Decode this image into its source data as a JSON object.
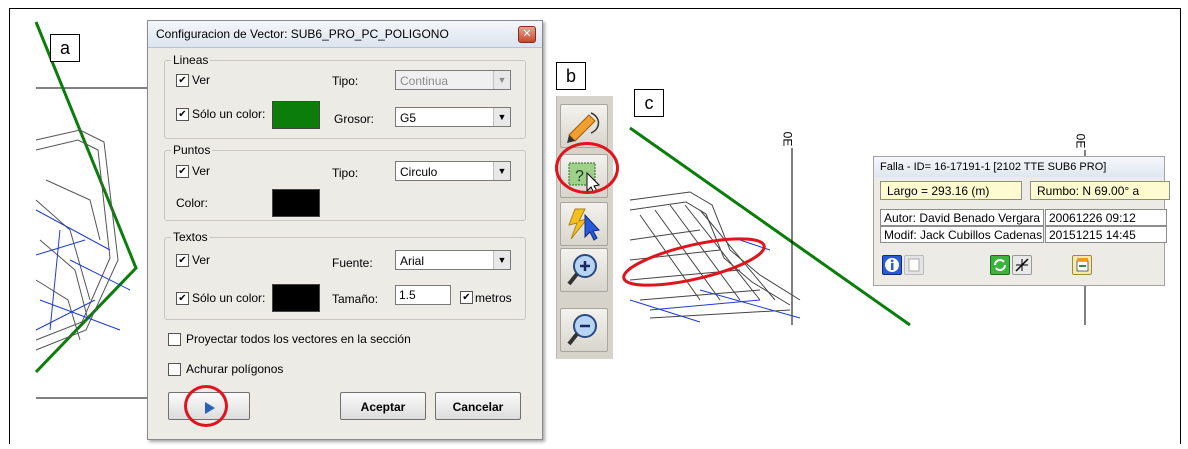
{
  "panels": {
    "a": "a",
    "b": "b",
    "c": "c"
  },
  "dialog": {
    "title": "Configuracion de Vector: SUB6_PRO_PC_POLIGONO",
    "close_glyph": "✕",
    "lineas": {
      "legend": "Lineas",
      "ver_label": "Ver",
      "ver_checked": true,
      "tipo_label": "Tipo:",
      "tipo_value": "Continua",
      "solo_label": "Sólo un color:",
      "solo_checked": true,
      "color": "#0a7d0a",
      "grosor_label": "Grosor:",
      "grosor_value": "G5"
    },
    "puntos": {
      "legend": "Puntos",
      "ver_label": "Ver",
      "ver_checked": true,
      "tipo_label": "Tipo:",
      "tipo_value": "Circulo",
      "color_label": "Color:",
      "color": "#000000"
    },
    "textos": {
      "legend": "Textos",
      "ver_label": "Ver",
      "ver_checked": true,
      "fuente_label": "Fuente:",
      "fuente_value": "Arial",
      "solo_label": "Sólo un color:",
      "solo_checked": true,
      "color": "#000000",
      "tamano_label": "Tamaño:",
      "tamano_value": "1.5",
      "metros_label": "metros",
      "metros_checked": true
    },
    "proyectar_label": "Proyectar todos los vectores en la sección",
    "proyectar_checked": false,
    "achurar_label": "Achurar polígonos",
    "achurar_checked": false,
    "accept_label": "Aceptar",
    "cancel_label": "Cancelar"
  },
  "toolbar": {
    "buttons": [
      "draw-vector-icon",
      "query-info-icon",
      "select-pointer-icon",
      "zoom-in-icon",
      "zoom-out-icon"
    ]
  },
  "section_view": {
    "axis_label_left": "0E",
    "axis_label_right": "0E"
  },
  "info_panel": {
    "title": "Falla - ID= 16-17191-1 [2102 TTE SUB6 PRO]",
    "largo": "Largo = 293.16 (m)",
    "rumbo": "Rumbo: N 69.00° a",
    "autor_label": "Autor: David Benado Vergara",
    "autor_date": "20061226 09:12",
    "modif_label": "Modif: Jack Cubillos Cadenas",
    "modif_date": "20151215 14:45"
  },
  "colors": {
    "highlight_ring": "#e0141c",
    "vector_green": "#0a7d0a",
    "mesh_blue": "#1f3bd6"
  }
}
